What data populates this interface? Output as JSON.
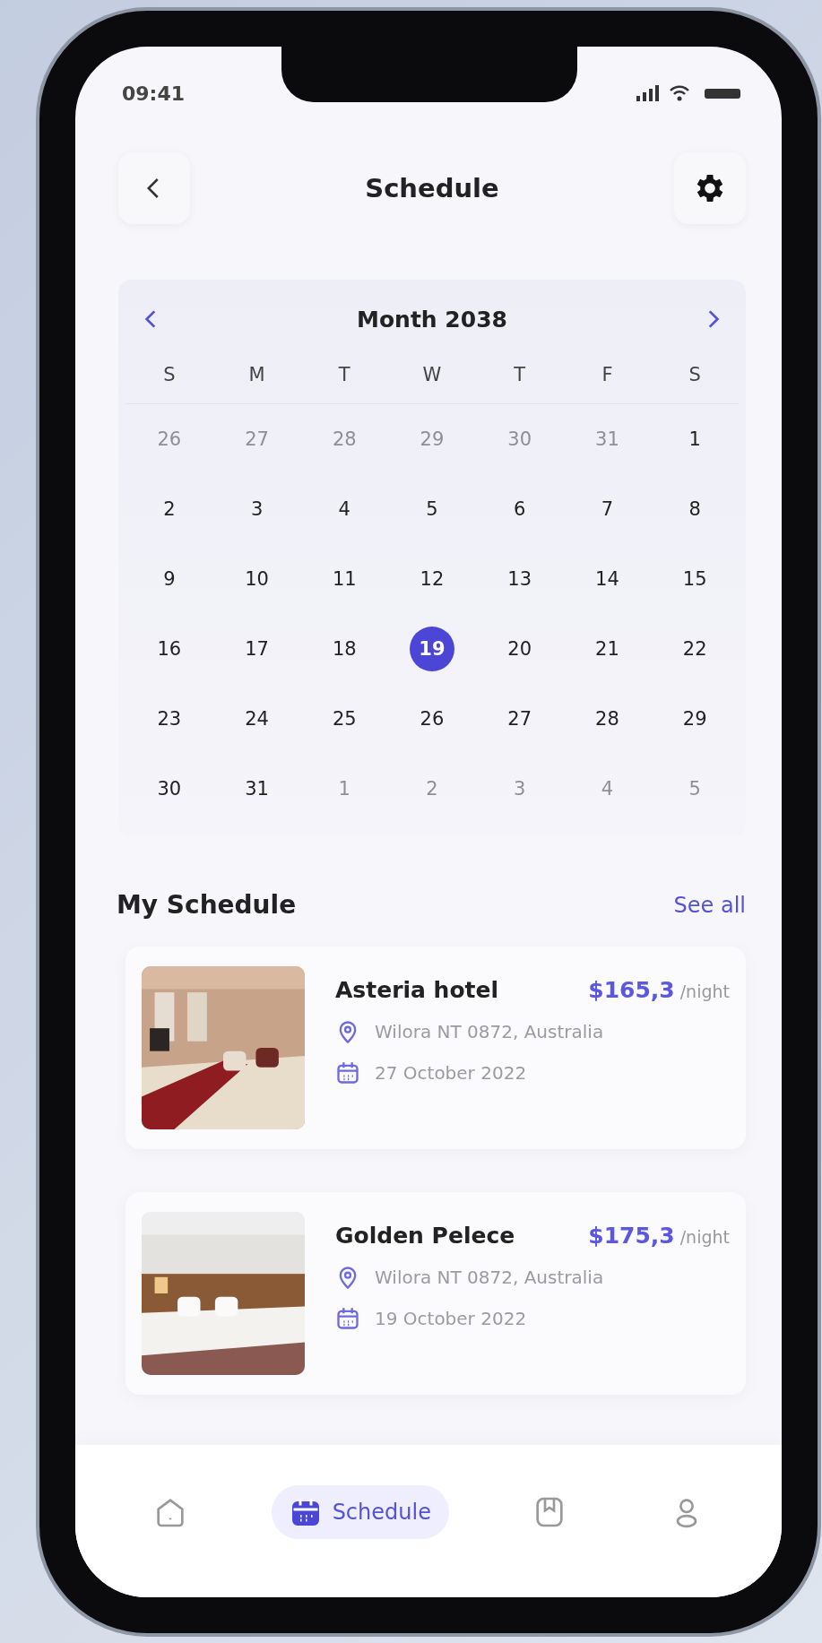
{
  "status_bar": {
    "time": "09:41"
  },
  "header": {
    "title": "Schedule"
  },
  "calendar": {
    "title": "Month 2038",
    "weekdays": [
      "S",
      "M",
      "T",
      "W",
      "T",
      "F",
      "S"
    ],
    "days": [
      {
        "text": "26",
        "outside": true,
        "selected": false
      },
      {
        "text": "27",
        "outside": true,
        "selected": false
      },
      {
        "text": "28",
        "outside": true,
        "selected": false
      },
      {
        "text": "29",
        "outside": true,
        "selected": false
      },
      {
        "text": "30",
        "outside": true,
        "selected": false
      },
      {
        "text": "31",
        "outside": true,
        "selected": false
      },
      {
        "text": "1",
        "outside": false,
        "selected": false
      },
      {
        "text": "2",
        "outside": false,
        "selected": false
      },
      {
        "text": "3",
        "outside": false,
        "selected": false
      },
      {
        "text": "4",
        "outside": false,
        "selected": false
      },
      {
        "text": "5",
        "outside": false,
        "selected": false
      },
      {
        "text": "6",
        "outside": false,
        "selected": false
      },
      {
        "text": "7",
        "outside": false,
        "selected": false
      },
      {
        "text": "8",
        "outside": false,
        "selected": false
      },
      {
        "text": "9",
        "outside": false,
        "selected": false
      },
      {
        "text": "10",
        "outside": false,
        "selected": false
      },
      {
        "text": "11",
        "outside": false,
        "selected": false
      },
      {
        "text": "12",
        "outside": false,
        "selected": false
      },
      {
        "text": "13",
        "outside": false,
        "selected": false
      },
      {
        "text": "14",
        "outside": false,
        "selected": false
      },
      {
        "text": "15",
        "outside": false,
        "selected": false
      },
      {
        "text": "16",
        "outside": false,
        "selected": false
      },
      {
        "text": "17",
        "outside": false,
        "selected": false
      },
      {
        "text": "18",
        "outside": false,
        "selected": false
      },
      {
        "text": "19",
        "outside": false,
        "selected": true
      },
      {
        "text": "20",
        "outside": false,
        "selected": false
      },
      {
        "text": "21",
        "outside": false,
        "selected": false
      },
      {
        "text": "22",
        "outside": false,
        "selected": false
      },
      {
        "text": "23",
        "outside": false,
        "selected": false
      },
      {
        "text": "24",
        "outside": false,
        "selected": false
      },
      {
        "text": "25",
        "outside": false,
        "selected": false
      },
      {
        "text": "26",
        "outside": false,
        "selected": false
      },
      {
        "text": "27",
        "outside": false,
        "selected": false
      },
      {
        "text": "28",
        "outside": false,
        "selected": false
      },
      {
        "text": "29",
        "outside": false,
        "selected": false
      },
      {
        "text": "30",
        "outside": false,
        "selected": false
      },
      {
        "text": "31",
        "outside": false,
        "selected": false
      },
      {
        "text": "1",
        "outside": true,
        "selected": false
      },
      {
        "text": "2",
        "outside": true,
        "selected": false
      },
      {
        "text": "3",
        "outside": true,
        "selected": false
      },
      {
        "text": "4",
        "outside": true,
        "selected": false
      },
      {
        "text": "5",
        "outside": true,
        "selected": false
      }
    ]
  },
  "schedule": {
    "title": "My Schedule",
    "link": "See all",
    "items": [
      {
        "name": "Asteria hotel",
        "price": "$165,3",
        "unit": "/night",
        "location": "Wilora NT 0872, Australia",
        "date": "27 October 2022",
        "kind": "picture"
      },
      {
        "name": "Golden Pelece",
        "price": "$175,3",
        "unit": "/night",
        "location": "Wilora NT 0872, Australia",
        "date": "19 October 2022",
        "kind": "picture"
      }
    ]
  },
  "nav": [
    {
      "kind": "home",
      "selected": false
    },
    {
      "kind": "calendar",
      "label": "Schedule",
      "selected": true
    },
    {
      "kind": "bookmark",
      "selected": false
    },
    {
      "kind": "profile",
      "selected": false
    }
  ]
}
